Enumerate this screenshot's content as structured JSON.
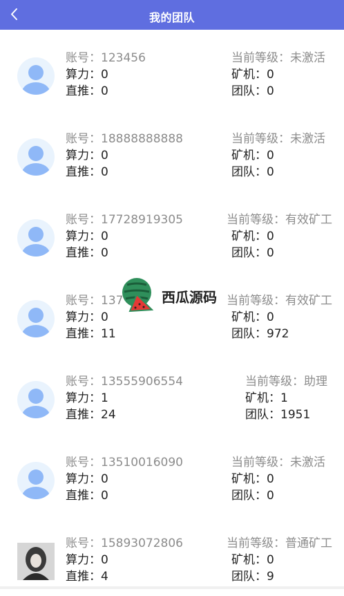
{
  "header": {
    "title": "我的团队"
  },
  "labels": {
    "account": "账号：",
    "power": "算力：",
    "direct": "直推：",
    "level": "当前等级：",
    "miner": "矿机：",
    "team": "团队："
  },
  "members": [
    {
      "account": "123456",
      "power": "0",
      "direct": "0",
      "level": "未激活",
      "miner": "0",
      "team": "0",
      "avatar": "default-avatar-icon"
    },
    {
      "account": "18888888888",
      "power": "0",
      "direct": "0",
      "level": "未激活",
      "miner": "0",
      "team": "0",
      "avatar": "default-avatar-icon"
    },
    {
      "account": "17728919305",
      "power": "0",
      "direct": "0",
      "level": "有效矿工",
      "miner": "0",
      "team": "0",
      "avatar": "default-avatar-icon"
    },
    {
      "account": "137",
      "power": "0",
      "direct": "11",
      "level": "有效矿工",
      "miner": "0",
      "team": "972",
      "avatar": "default-avatar-icon"
    },
    {
      "account": "13555906554",
      "power": "1",
      "direct": "24",
      "level": "助理",
      "miner": "1",
      "team": "1951",
      "avatar": "default-avatar-icon"
    },
    {
      "account": "13510016090",
      "power": "0",
      "direct": "0",
      "level": "未激活",
      "miner": "0",
      "team": "0",
      "avatar": "default-avatar-icon"
    },
    {
      "account": "15893072806",
      "power": "0",
      "direct": "4",
      "level": "普通矿工",
      "miner": "0",
      "team": "9",
      "avatar": "photo-avatar"
    }
  ],
  "watermark": {
    "text": "西瓜源码",
    "icon": "watermelon-icon"
  },
  "colors": {
    "header": "#5f6ee0",
    "muted": "#8c8c8c",
    "avatar_bg": "#e9f3fd",
    "avatar_fg": "#8fb8f7"
  }
}
